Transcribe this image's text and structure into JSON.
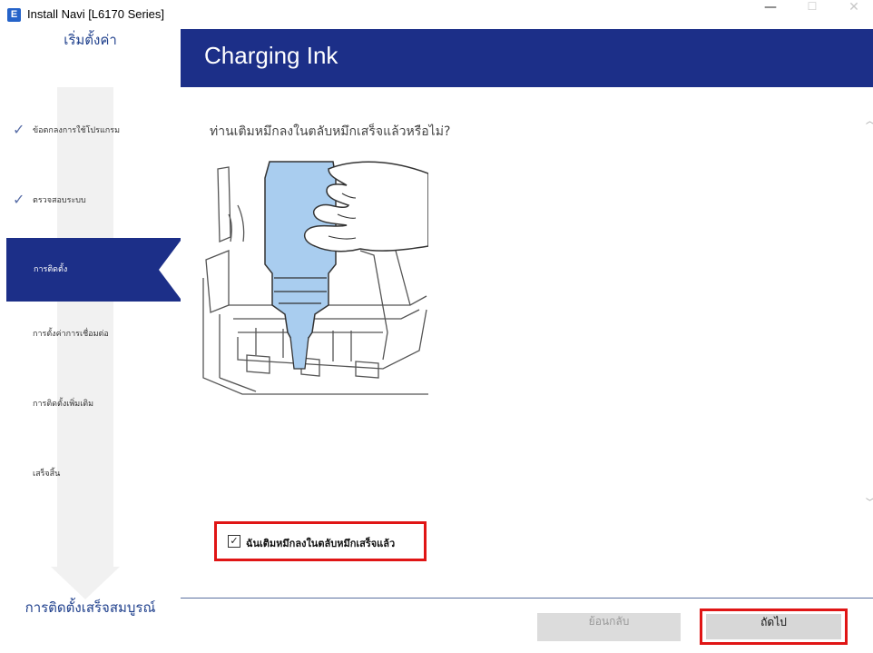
{
  "window": {
    "icon_letter": "E",
    "title": "Install Navi [L6170 Series]",
    "minimize": "—",
    "maximize": "☐",
    "close": "✕"
  },
  "sidebar": {
    "setup_label": "เริ่มตั้งค่า",
    "items": [
      {
        "label": "ข้อตกลงการใช้โปรแกรม",
        "status": "done"
      },
      {
        "label": "ตรวจสอบระบบ",
        "status": "done"
      },
      {
        "label": "การติดตั้ง",
        "status": "active"
      },
      {
        "label": "การตั้งค่าการเชื่อมต่อ",
        "status": "pending"
      },
      {
        "label": "การติดตั้งเพิ่มเติม",
        "status": "pending"
      },
      {
        "label": "เสร็จสิ้น",
        "status": "pending"
      }
    ],
    "check_mark": "✓",
    "complete_label": "การติดตั้งเสร็จสมบูรณ์"
  },
  "header": {
    "title": "Charging Ink"
  },
  "content": {
    "question": "ท่านเติมหมึกลงในตลับหมึกเสร็จแล้วหรือไม่?",
    "illustration": "hand-filling-ink-bottle-icon",
    "confirm_checked": true,
    "confirm_check_glyph": "✓",
    "confirm_label": "ฉันเติมหมึกลงในตลับหมึกเสร็จแล้ว"
  },
  "footer": {
    "back_label": "ย้อนกลับ",
    "next_label": "ถัดไป"
  },
  "colors": {
    "brand_blue": "#1c2f88",
    "highlight_red": "#e01515",
    "ink_blue": "#a9cdef"
  }
}
